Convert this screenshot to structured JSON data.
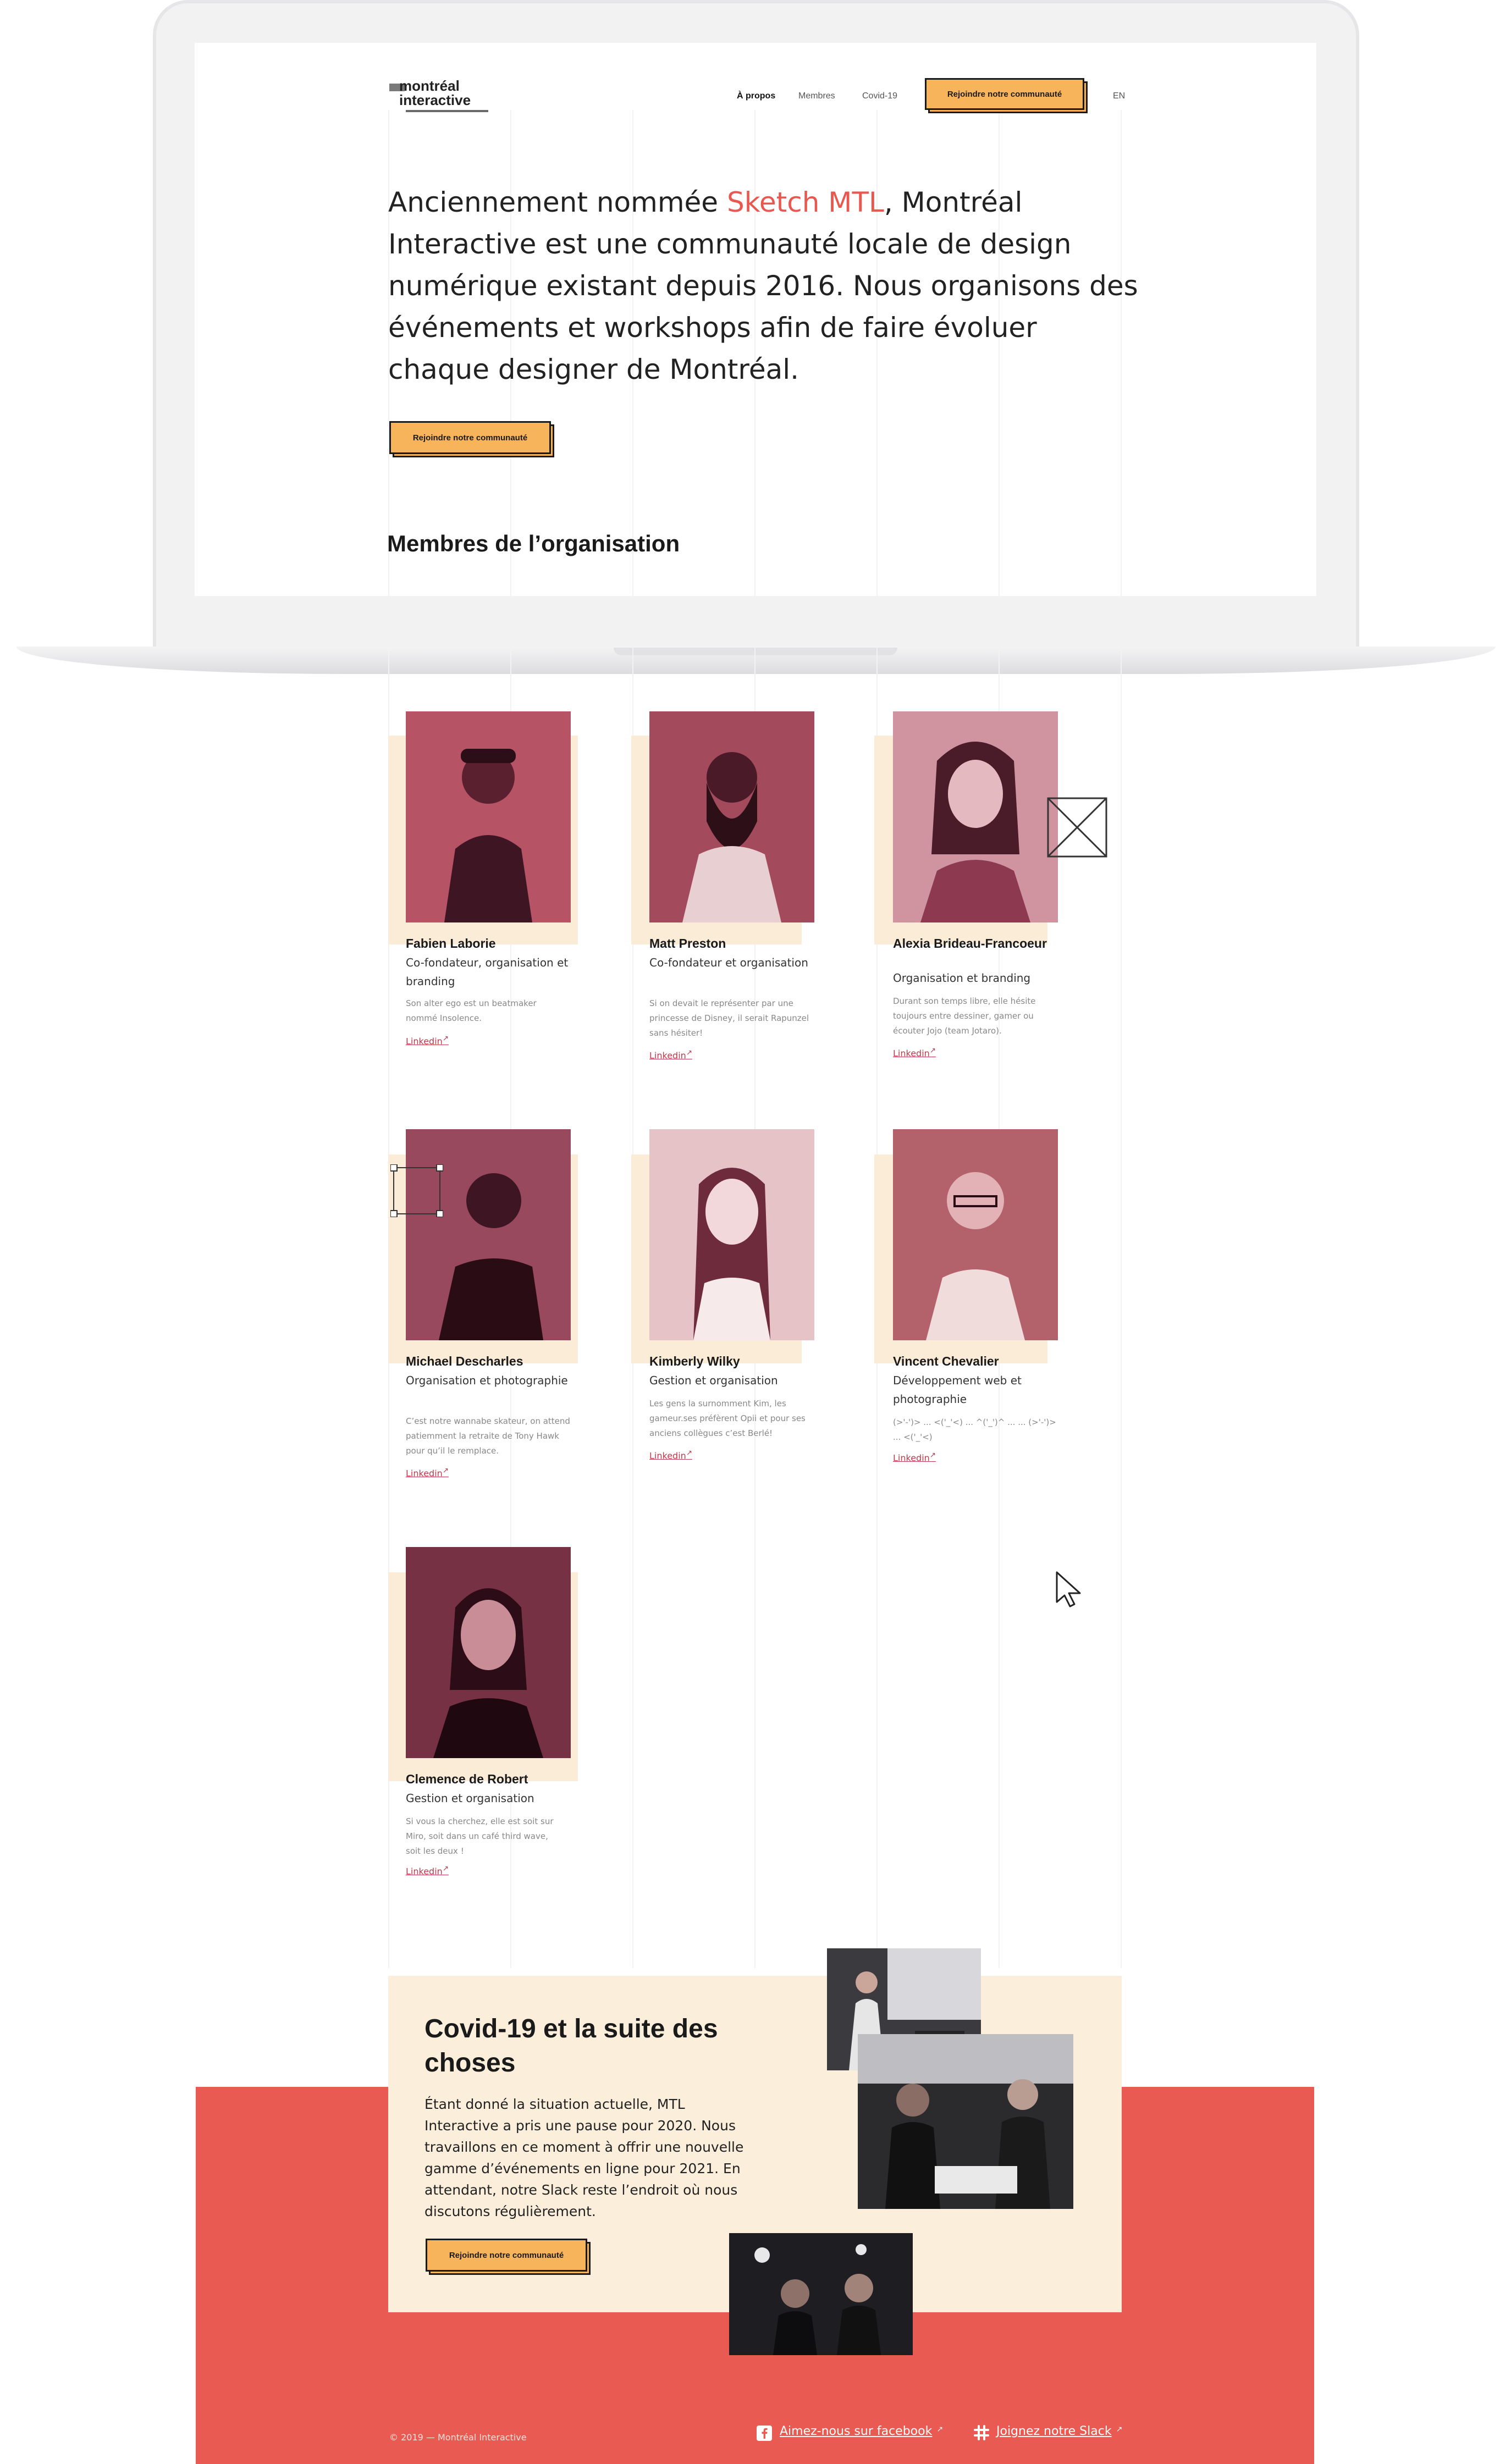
{
  "header": {
    "logo_line1": "montréal",
    "logo_line2": "interactive",
    "nav": [
      "À propos",
      "Membres",
      "Covid-19"
    ],
    "cta": "Rejoindre notre communauté",
    "lang": "EN"
  },
  "hero": {
    "text_before": "Anciennement nommée ",
    "text_accent": "Sketch MTL",
    "text_after": ", Montréal Interactive est une communauté locale de design numérique existant depuis 2016. Nous organisons des événements et workshops afin de faire évoluer chaque designer de Montréal.",
    "cta": "Rejoindre notre communauté"
  },
  "members_title": "Membres de l’organisation",
  "members": [
    {
      "name": "Fabien Laborie",
      "role": "Co-fondateur, organisation et branding",
      "bio": "Son alter ego est un beatmaker nommé Insolence.",
      "link": "Linkedin"
    },
    {
      "name": "Matt Preston",
      "role": "Co-fondateur et organisation",
      "bio": "Si on devait le représenter par une princesse de Disney, il serait Rapunzel sans hésiter!",
      "link": "Linkedin"
    },
    {
      "name": "Alexia Brideau-Francoeur",
      "role": "Organisation et branding",
      "bio": "Durant son temps libre, elle hésite toujours entre dessiner, gamer ou écouter Jojo (team Jotaro).",
      "link": "Linkedin"
    },
    {
      "name": "Michael Descharles",
      "role": "Organisation et photographie",
      "bio": "C’est notre wannabe skateur, on attend patiemment la retraite de Tony Hawk pour qu’il le remplace.",
      "link": "Linkedin"
    },
    {
      "name": "Kimberly Wilky",
      "role": "Gestion et organisation",
      "bio": "Les gens la surnomment Kim, les gameur.ses préfèrent Opii et pour ses anciens collègues c’est Berlé!",
      "link": "Linkedin"
    },
    {
      "name": "Vincent Chevalier",
      "role": "Développement web et photographie",
      "bio": "(>'-')> ... <('_'<) ... ^('_')^ ... ... (>'-')> ... <('_'<)",
      "link": "Linkedin"
    },
    {
      "name": "Clemence de Robert",
      "role": "Gestion et organisation",
      "bio": "Si vous la cherchez, elle est soit sur Miro, soit dans un café third wave, soit les deux !",
      "link": "Linkedin"
    }
  ],
  "covid": {
    "title": "Covid-19 et la suite des choses",
    "text": "Étant donné la situation actuelle, MTL Interactive a pris une pause pour 2020. Nous travaillons en ce moment à offrir une nouvelle gamme d’événements en ligne pour 2021. En attendant, notre Slack reste l’endroit où nous discutons régulièrement.",
    "cta": "Rejoindre notre communauté"
  },
  "footer": {
    "copyright": "© 2019 — Montréal Interactive",
    "facebook": "Aimez-nous sur facebook",
    "slack": "Joignez notre Slack",
    "arrow": "↗"
  },
  "colors": {
    "accent": "#e8584f",
    "button": "#f7b45b",
    "cream": "#fbeedb",
    "link": "#c2384b"
  }
}
